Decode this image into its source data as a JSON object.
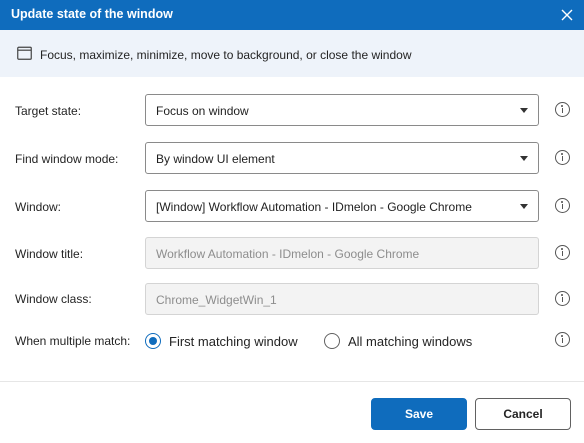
{
  "dialog": {
    "title": "Update state of the window",
    "description": "Focus, maximize, minimize, move to background, or close the window",
    "icons": {
      "close": "close-icon",
      "window": "window-icon",
      "info": "info-icon",
      "dropdown": "chevron-down-icon"
    }
  },
  "fields": {
    "target_state": {
      "label": "Target state:",
      "value": "Focus on window"
    },
    "find_mode": {
      "label": "Find window mode:",
      "value": "By window UI element"
    },
    "window": {
      "label": "Window:",
      "value": "[Window] Workflow Automation - IDmelon - Google Chrome"
    },
    "window_title": {
      "label": "Window title:",
      "placeholder": "Workflow Automation - IDmelon - Google Chrome"
    },
    "window_class": {
      "label": "Window class:",
      "placeholder": "Chrome_WidgetWin_1"
    },
    "multiple_match": {
      "label": "When multiple match:",
      "options": [
        {
          "label": "First matching window",
          "selected": true
        },
        {
          "label": "All matching windows",
          "selected": false
        }
      ]
    }
  },
  "buttons": {
    "save": "Save",
    "cancel": "Cancel"
  },
  "colors": {
    "accent": "#0f6cbd",
    "header_bg": "#0f6cbd",
    "description_bg": "#eef3fa"
  }
}
